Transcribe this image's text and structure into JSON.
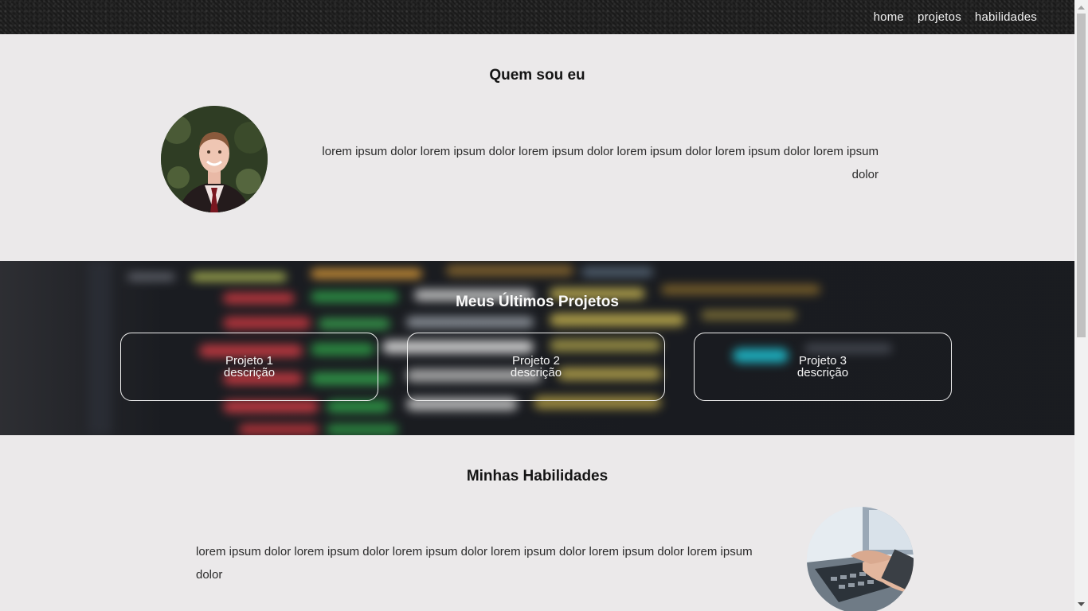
{
  "nav": {
    "items": [
      {
        "label": "home"
      },
      {
        "label": "projetos"
      },
      {
        "label": "habilidades"
      }
    ]
  },
  "about": {
    "title": "Quem sou eu",
    "text": "lorem ipsum dolor lorem ipsum dolor lorem ipsum dolor lorem ipsum dolor lorem ipsum dolor lorem ipsum dolor",
    "image": "profile-photo"
  },
  "projects": {
    "title": "Meus Últimos Projetos",
    "cards": [
      {
        "name": "Projeto 1",
        "desc": "descrição"
      },
      {
        "name": "Projeto 2",
        "desc": "descrição"
      },
      {
        "name": "Projeto 3",
        "desc": "descrição"
      }
    ]
  },
  "skills": {
    "title": "Minhas Habilidades",
    "text": "lorem ipsum dolor lorem ipsum dolor lorem ipsum dolor lorem ipsum dolor lorem ipsum dolor lorem ipsum dolor",
    "image": "laptop-typing-photo"
  },
  "colors": {
    "background": "#ebe9ea",
    "header": "#1d1d1d",
    "projects_bg": "#1c1e23",
    "text": "#1f1f1f"
  }
}
